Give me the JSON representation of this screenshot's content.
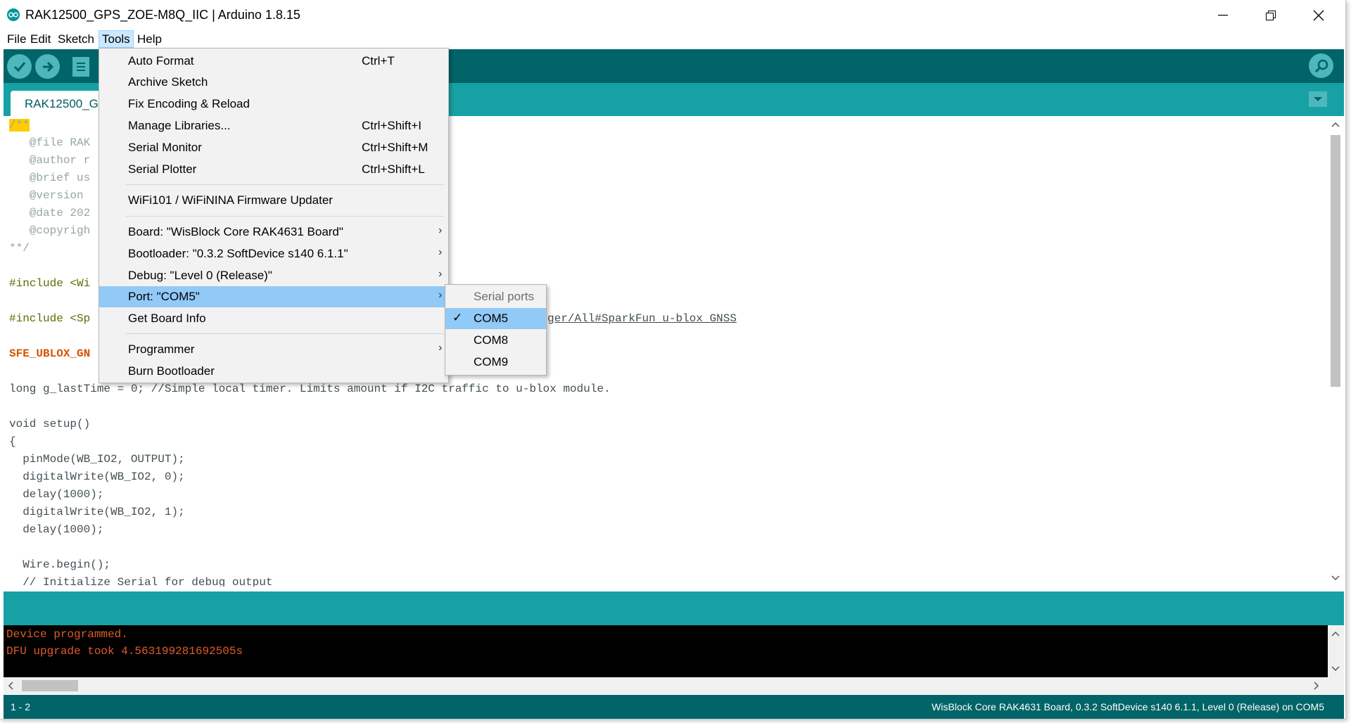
{
  "window": {
    "title": "RAK12500_GPS_ZOE-M8Q_IIC | Arduino 1.8.15",
    "minimize_glyph": "—",
    "restore_glyph": "❐",
    "close_glyph": "✕"
  },
  "menubar": {
    "items": [
      "File",
      "Edit",
      "Sketch",
      "Tools",
      "Help"
    ],
    "active": "Tools"
  },
  "tab": {
    "label": "RAK12500_G"
  },
  "editor": {
    "lines": [
      "/**",
      "   @file RAK",
      "   @author r",
      "   @brief us",
      "   @version ",
      "   @date 202",
      "   @copyrigh",
      "**/",
      "",
      "#include <Wi",
      "",
      "#include <Sp",
      "",
      "SFE_UBLOX_GN",
      "",
      "long g_lastTime = 0; //Simple local timer. Limits amount if I2C traffic to u-blox module.",
      "",
      "void setup()",
      "{",
      "  pinMode(WB_IO2, OUTPUT);",
      "  digitalWrite(WB_IO2, 0);",
      "  delay(1000);",
      "  digitalWrite(WB_IO2, 1);",
      "  delay(1000);",
      "",
      "  Wire.begin();",
      "  // Initialize Serial for debug output"
    ],
    "link_fragment": "ger/All#SparkFun_u-blox_GNSS"
  },
  "tools_menu": {
    "items": [
      {
        "label": "Auto Format",
        "shortcut": "Ctrl+T"
      },
      {
        "label": "Archive Sketch",
        "shortcut": ""
      },
      {
        "label": "Fix Encoding & Reload",
        "shortcut": ""
      },
      {
        "label": "Manage Libraries...",
        "shortcut": "Ctrl+Shift+I"
      },
      {
        "label": "Serial Monitor",
        "shortcut": "Ctrl+Shift+M"
      },
      {
        "label": "Serial Plotter",
        "shortcut": "Ctrl+Shift+L"
      },
      {
        "label": "WiFi101 / WiFiNINA Firmware Updater",
        "shortcut": ""
      },
      {
        "label": "Board: \"WisBlock Core RAK4631 Board\"",
        "shortcut": ""
      },
      {
        "label": "Bootloader: \"0.3.2 SoftDevice s140 6.1.1\"",
        "shortcut": ""
      },
      {
        "label": "Debug: \"Level 0 (Release)\"",
        "shortcut": ""
      },
      {
        "label": "Port: \"COM5\"",
        "shortcut": ""
      },
      {
        "label": "Get Board Info",
        "shortcut": ""
      },
      {
        "label": "Programmer",
        "shortcut": ""
      },
      {
        "label": "Burn Bootloader",
        "shortcut": ""
      }
    ],
    "submenu_arrow": "›"
  },
  "port_submenu": {
    "header": "Serial ports",
    "ports": [
      "COM5",
      "COM8",
      "COM9"
    ],
    "selected": "COM5",
    "check_glyph": "✓"
  },
  "console": {
    "lines": [
      "Device programmed.",
      "DFU upgrade took 4.563199281692505s"
    ]
  },
  "statusbar": {
    "line": "1 - 2",
    "board_info": "WisBlock Core RAK4631 Board, 0.3.2 SoftDevice s140 6.1.1, Level 0 (Release) on COM5"
  },
  "colors": {
    "teal_dark": "#006468",
    "teal": "#17a1a5",
    "button": "#4db7bb",
    "menu_highlight": "#91c9f7",
    "console_text": "#e05a2b",
    "comment": "#95a5a6",
    "keyword_orange": "#d35400",
    "function_orange": "#d35400",
    "constant_blue": "#00979c"
  }
}
